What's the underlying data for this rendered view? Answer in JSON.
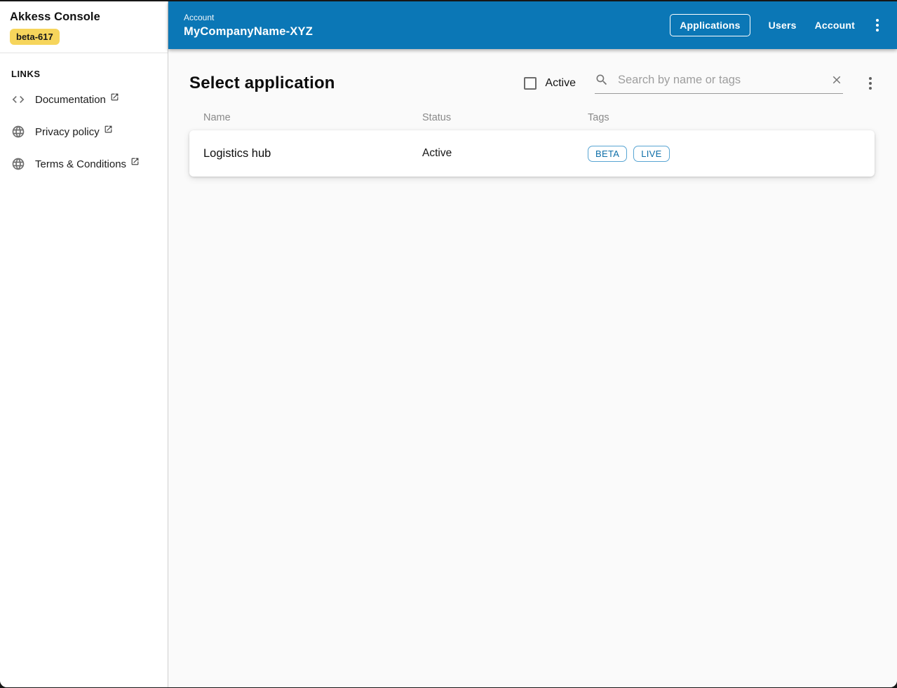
{
  "sidebar": {
    "app_title": "Akkess Console",
    "version_badge": "beta-617",
    "links_header": "LINKS",
    "items": [
      {
        "label": "Documentation",
        "icon": "code-icon"
      },
      {
        "label": "Privacy policy",
        "icon": "globe-icon"
      },
      {
        "label": "Terms & Conditions",
        "icon": "globe-icon"
      }
    ]
  },
  "appbar": {
    "overline": "Account",
    "title": "MyCompanyName-XYZ",
    "nav": [
      {
        "label": "Applications",
        "active": true
      },
      {
        "label": "Users",
        "active": false
      },
      {
        "label": "Account",
        "active": false
      }
    ]
  },
  "main": {
    "title": "Select application",
    "filter": {
      "label": "Active",
      "checked": false
    },
    "search": {
      "placeholder": "Search by name or tags",
      "value": ""
    },
    "table": {
      "columns": [
        "Name",
        "Status",
        "Tags"
      ],
      "rows": [
        {
          "name": "Logistics hub",
          "status": "Active",
          "tags": [
            "BETA",
            "LIVE"
          ]
        }
      ]
    }
  },
  "colors": {
    "appbar_bg": "#0b77b6",
    "badge_bg": "#f6d55c",
    "tag_border": "#58a5d3",
    "tag_text": "#0d6ea8",
    "content_bg": "#fafafa"
  }
}
